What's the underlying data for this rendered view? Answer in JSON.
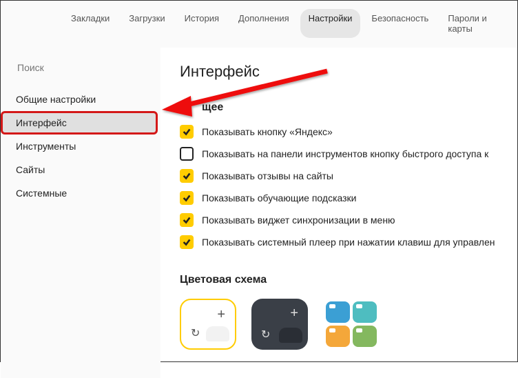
{
  "topnav": [
    {
      "label": "Закладки",
      "active": false
    },
    {
      "label": "Загрузки",
      "active": false
    },
    {
      "label": "История",
      "active": false
    },
    {
      "label": "Дополнения",
      "active": false
    },
    {
      "label": "Настройки",
      "active": true
    },
    {
      "label": "Безопасность",
      "active": false
    },
    {
      "label": "Пароли и карты",
      "active": false
    }
  ],
  "search": {
    "placeholder": "Поиск"
  },
  "sidebar": [
    {
      "label": "Общие настройки",
      "active": false
    },
    {
      "label": "Интерфейс",
      "active": true
    },
    {
      "label": "Инструменты",
      "active": false
    },
    {
      "label": "Сайты",
      "active": false
    },
    {
      "label": "Системные",
      "active": false
    }
  ],
  "main": {
    "title": "Интерфейс",
    "general_section": "щее",
    "checks": [
      {
        "checked": true,
        "label": "Показывать кнопку «Яндекс»"
      },
      {
        "checked": false,
        "label": "Показывать на панели инструментов кнопку быстрого доступа к"
      },
      {
        "checked": true,
        "label": "Показывать отзывы на сайты"
      },
      {
        "checked": true,
        "label": "Показывать обучающие подсказки"
      },
      {
        "checked": true,
        "label": "Показывать виджет синхронизации в меню"
      },
      {
        "checked": true,
        "label": "Показывать системный плеер при нажатии клавиш для управлен"
      }
    ],
    "theme_section": "Цветовая схема"
  }
}
